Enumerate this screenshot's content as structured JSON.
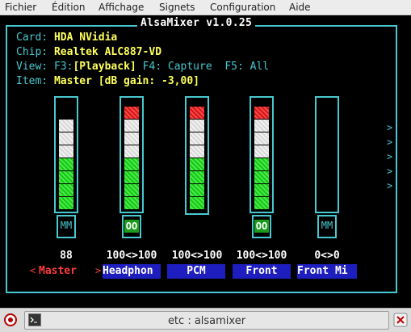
{
  "menubar": {
    "items": [
      "Fichier",
      "Édition",
      "Affichage",
      "Signets",
      "Configuration",
      "Aide"
    ]
  },
  "mixer": {
    "title": "AlsaMixer v1.0.25",
    "card_label": "Card:",
    "card_value": "HDA NVidia",
    "chip_label": "Chip:",
    "chip_value": "Realtek ALC887-VD",
    "view_label": "View:",
    "view_f3": "F3:",
    "view_f3_value": "[Playback]",
    "view_f4": "F4: Capture",
    "view_f5": "F5: All",
    "item_label": "Item:",
    "item_value": "Master [dB gain: -3,00]",
    "scroll_indicator": ">",
    "selection_left_marker": "<",
    "selection_right_marker": ">",
    "channels": [
      {
        "name": "Master",
        "volume": "88",
        "mute": "MM",
        "selected": true
      },
      {
        "name": "Headphon",
        "volume": "100<>100",
        "mute": "OO",
        "selected": false
      },
      {
        "name": "PCM",
        "volume": "100<>100",
        "mute": "",
        "selected": false
      },
      {
        "name": "Front",
        "volume": "100<>100",
        "mute": "OO",
        "selected": false
      },
      {
        "name": "Front Mi",
        "volume": "0<>0",
        "mute": "MM",
        "selected": false
      }
    ],
    "colors": {
      "frame": "#48c8d0",
      "value": "#ffff5c",
      "name_bg": "#1e1ebe",
      "selected": "#ff3c3c",
      "unmuted": "#1c9c1c"
    }
  },
  "taskbar": {
    "window_title": "etc : alsamixer",
    "terminal_icon": "terminal-icon",
    "close_icon": "close-icon"
  }
}
